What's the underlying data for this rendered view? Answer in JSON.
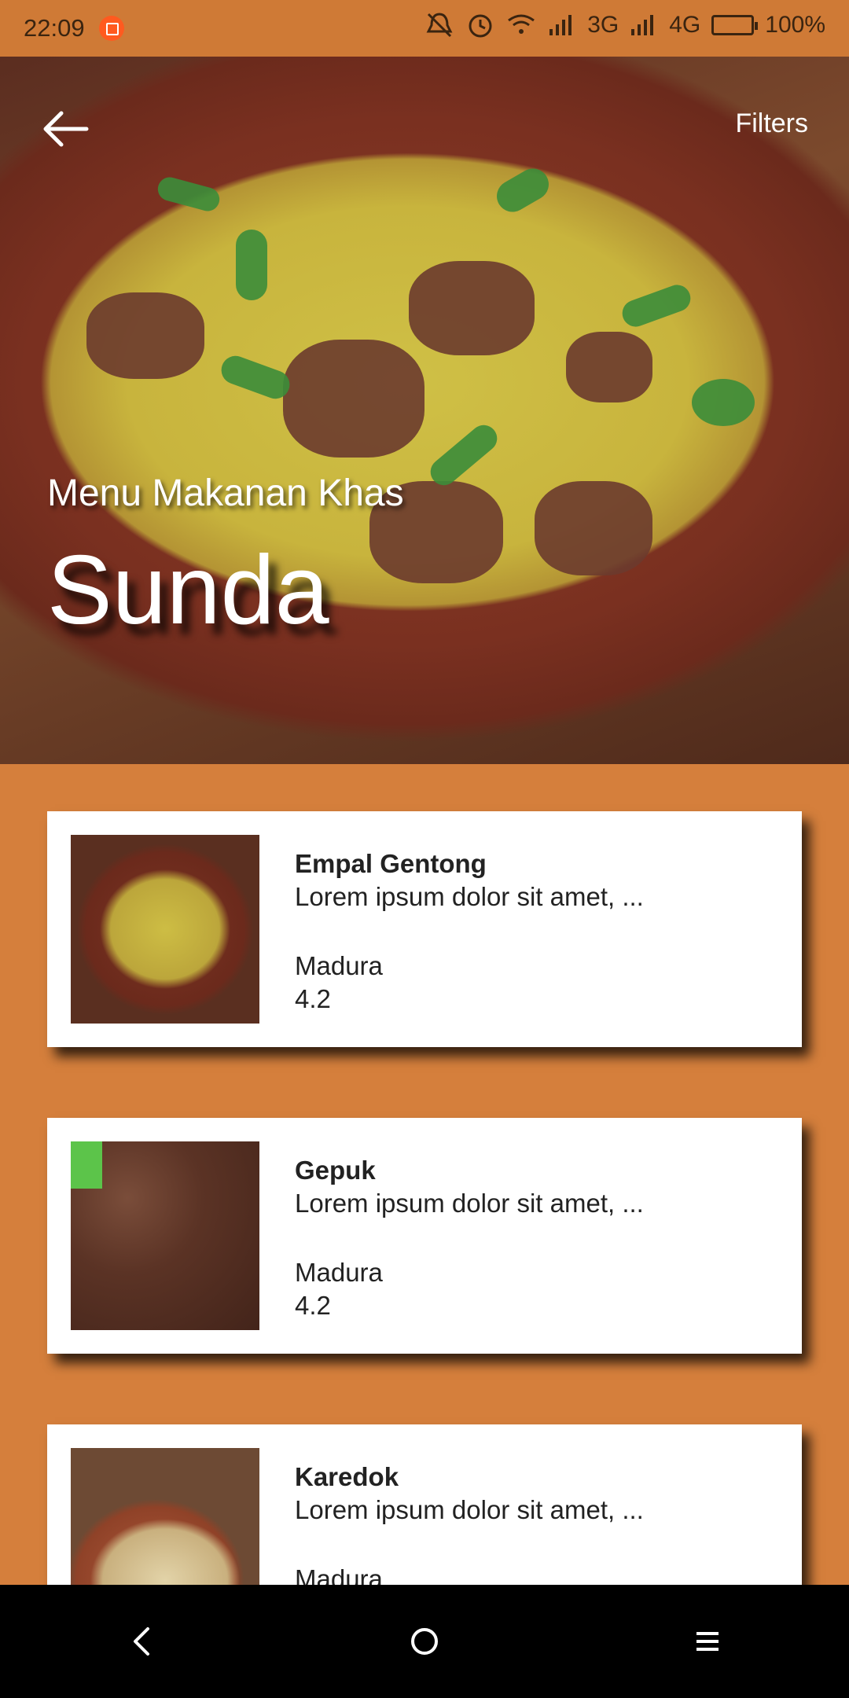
{
  "status_bar": {
    "time": "22:09",
    "network_1": "3G",
    "network_2": "4G",
    "battery": "100%"
  },
  "header": {
    "filters_label": "Filters",
    "subtitle": "Menu Makanan Khas",
    "title": "Sunda"
  },
  "menu_items": [
    {
      "name": "Empal Gentong",
      "description": "Lorem ipsum dolor sit amet, ...",
      "origin": "Madura",
      "rating": "4.2"
    },
    {
      "name": "Gepuk",
      "description": "Lorem ipsum dolor sit amet, ...",
      "origin": "Madura",
      "rating": "4.2"
    },
    {
      "name": "Karedok",
      "description": "Lorem ipsum dolor sit amet, ...",
      "origin": "Madura",
      "rating": ""
    }
  ],
  "nav": {
    "icons": [
      "back-triangle-icon",
      "home-circle-icon",
      "menu-lines-icon"
    ]
  },
  "colors": {
    "background": "#d57f3c",
    "status_bar": "#cf7a36",
    "card": "#ffffff"
  }
}
